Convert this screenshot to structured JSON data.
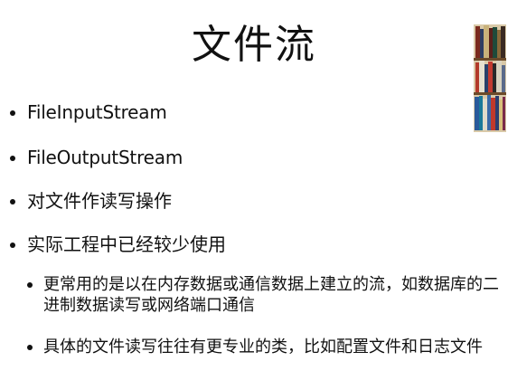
{
  "slide": {
    "title": "文件流",
    "bullets": [
      {
        "text": "FileInputStream",
        "level": 1
      },
      {
        "text": "FileOutputStream",
        "level": 1
      },
      {
        "text": "对文件作读写操作",
        "level": 1
      },
      {
        "text": "实际工程中已经较少使用",
        "level": 1
      },
      {
        "text": "更常用的是以在内存数据或通信数据上建立的流，如数据库的二进制数据读写或网络端口通信",
        "level": 2
      },
      {
        "text": "具体的文件读写往往有更专业的类，比如配置文件和日志文件",
        "level": 2
      }
    ],
    "image": {
      "icon": "bookshelf-icon"
    }
  }
}
